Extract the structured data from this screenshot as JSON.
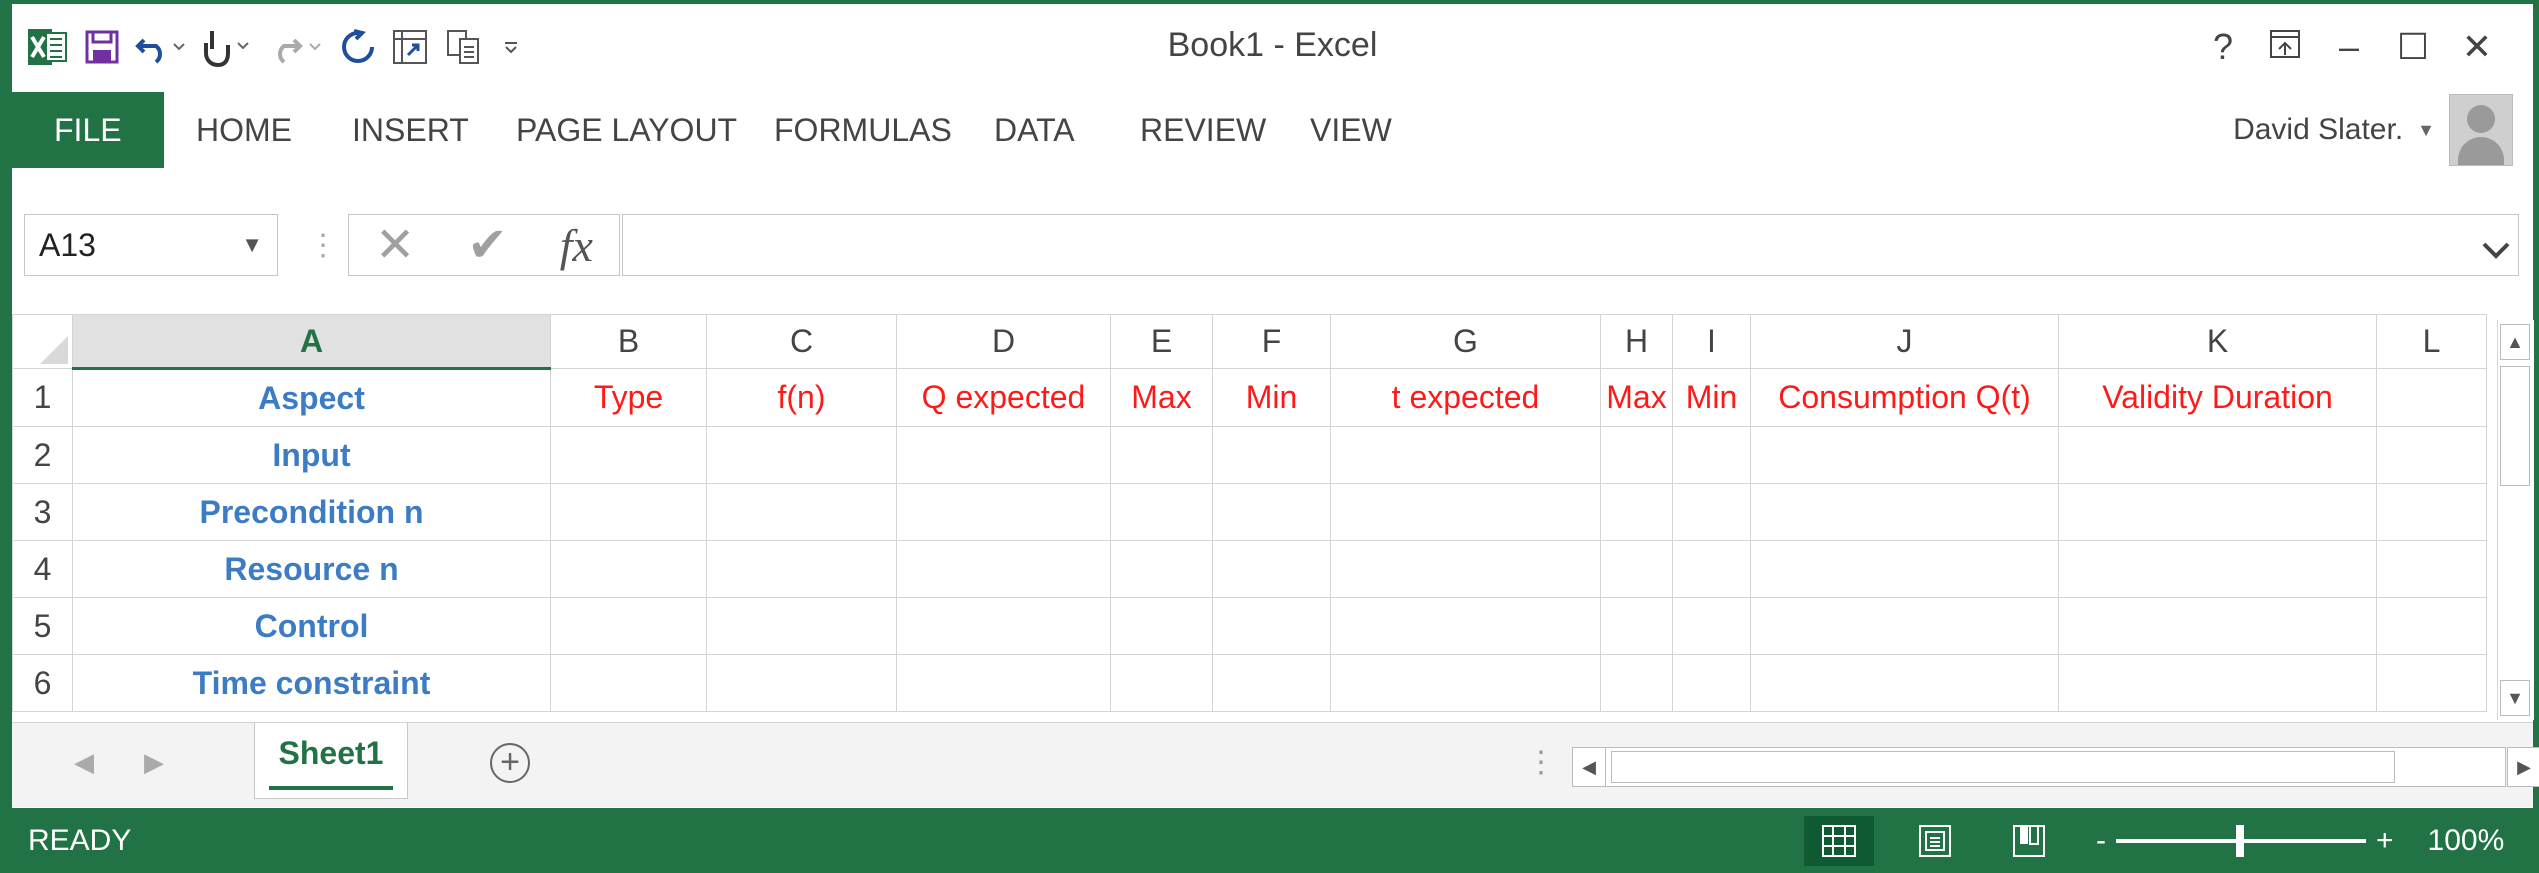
{
  "app": {
    "title": "Book1 - Excel",
    "accent": "#217346"
  },
  "qat": {
    "icons": [
      "excel-logo-icon",
      "save-icon",
      "undo-icon",
      "touch-mode-icon",
      "redo-icon",
      "refresh-icon",
      "pivot-icon",
      "copy-icon",
      "customize-icon"
    ]
  },
  "window": {
    "help": "?",
    "minimize": "–",
    "maximize": "☐",
    "close": "✕"
  },
  "ribbon": {
    "tabs": [
      "FILE",
      "HOME",
      "INSERT",
      "PAGE LAYOUT",
      "FORMULAS",
      "DATA",
      "REVIEW",
      "VIEW"
    ],
    "user": "David Slater."
  },
  "formula_bar": {
    "name_box": "A13",
    "cancel": "✕",
    "enter": "✔",
    "fx": "fx",
    "value": ""
  },
  "grid": {
    "selected_column": "A",
    "columns": [
      "A",
      "B",
      "C",
      "D",
      "E",
      "F",
      "G",
      "H",
      "I",
      "J",
      "K",
      "L"
    ],
    "rows": [
      "1",
      "2",
      "3",
      "4",
      "5",
      "6"
    ],
    "header_row": [
      "Aspect",
      "Type",
      "f(n)",
      "Q expected",
      "Max",
      "Min",
      "t expected",
      "Max",
      "Min",
      "Consumption Q(t)",
      "Validity Duration",
      ""
    ],
    "aspects": [
      "Input",
      "Precondition n",
      "Resource n",
      "Control",
      "Time constraint"
    ],
    "header_color": "#ff1a1a",
    "aspect_color": "#3c7cc4"
  },
  "sheets": {
    "tabs": [
      "Sheet1"
    ],
    "add": "+"
  },
  "status": {
    "text": "READY",
    "zoom_minus": "-",
    "zoom_plus": "+",
    "zoom": "100%",
    "zoom_level": 1.0
  }
}
